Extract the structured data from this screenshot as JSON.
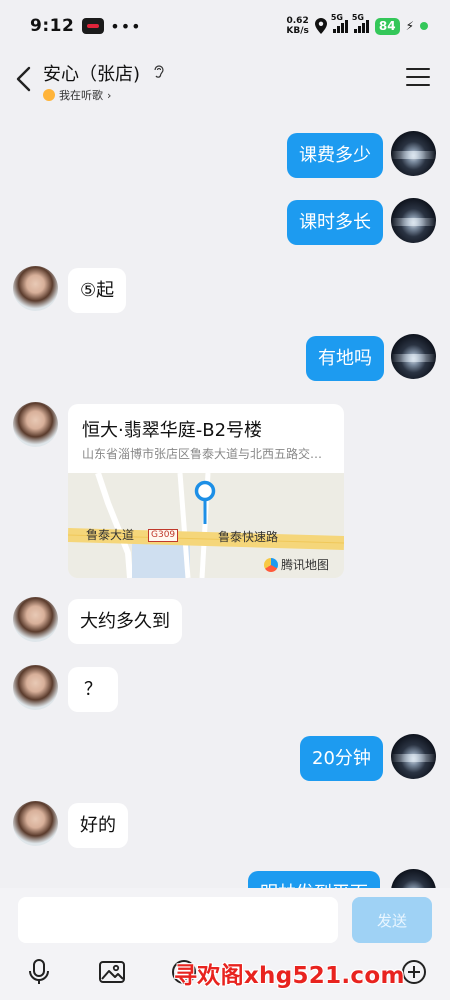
{
  "status_bar": {
    "time": "9:12",
    "dots": "•••",
    "net_speed_value": "0.62",
    "net_speed_unit": "KB/s",
    "sim1": "5G",
    "sim2": "5G",
    "battery": "84"
  },
  "header": {
    "title": "安心（张店)",
    "subtitle": "我在听歌",
    "subtitle_chevron": "›"
  },
  "messages": [
    {
      "side": "out",
      "text": "课费多少"
    },
    {
      "side": "out",
      "text": "课时多长"
    },
    {
      "side": "in",
      "text": "⑤起"
    },
    {
      "side": "out",
      "text": "有地吗"
    },
    {
      "side": "in",
      "type": "location"
    },
    {
      "side": "in",
      "text": "大约多久到"
    },
    {
      "side": "in",
      "text": "？"
    },
    {
      "side": "out",
      "text": "20分钟"
    },
    {
      "side": "in",
      "text": "好的"
    },
    {
      "side": "out",
      "text": "明林发到平面"
    }
  ],
  "location_card": {
    "title": "恒大·翡翠华庭-B2号楼",
    "address": "山东省淄博市张店区鲁泰大道与北西五路交叉口",
    "road_1": "鲁泰大道",
    "road_badge": "G309",
    "road_2": "鲁泰快速路",
    "map_provider": "腾讯地图"
  },
  "input_bar": {
    "placeholder": "",
    "send_label": "发送"
  },
  "toolbar": [
    "mic-icon",
    "image-icon",
    "emoji-icon",
    "plus-icon"
  ],
  "watermark": "寻欢阁xhg521.com",
  "colors": {
    "outgoing_bubble": "#1d9bf0",
    "incoming_bubble": "#ffffff",
    "background": "#f0f0f3",
    "send_disabled": "#9fd2f5",
    "battery": "#34c759"
  }
}
